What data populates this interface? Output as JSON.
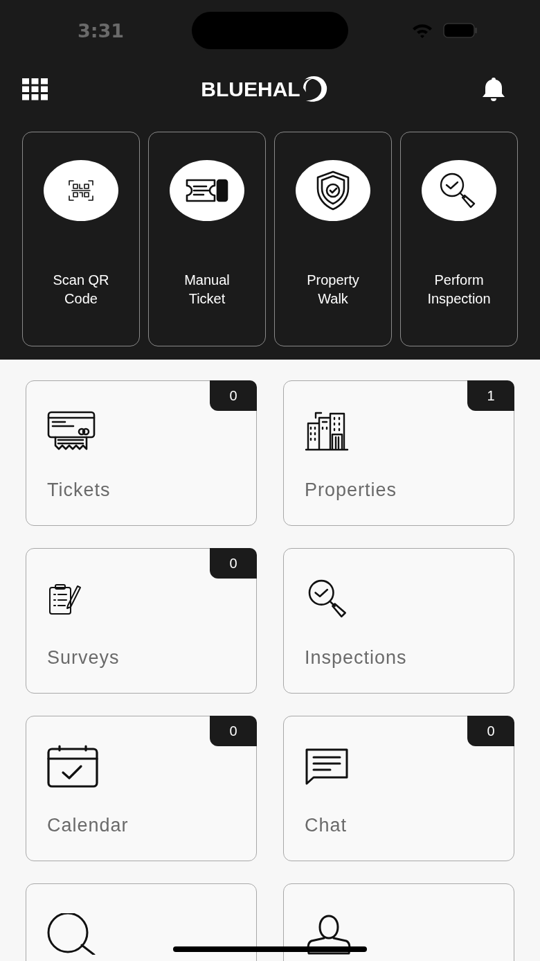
{
  "status_bar": {
    "time": "3:31"
  },
  "nav": {
    "logo": "BLUEHAL"
  },
  "quick_actions": [
    {
      "label": "Scan QR Code"
    },
    {
      "label": "Manual Ticket"
    },
    {
      "label": "Property Walk"
    },
    {
      "label": "Perform Inspection"
    }
  ],
  "modules": [
    {
      "label": "Tickets",
      "badge": "0"
    },
    {
      "label": "Properties",
      "badge": "1"
    },
    {
      "label": "Surveys",
      "badge": "0"
    },
    {
      "label": "Inspections"
    },
    {
      "label": "Calendar",
      "badge": "0"
    },
    {
      "label": "Chat",
      "badge": "0"
    }
  ]
}
